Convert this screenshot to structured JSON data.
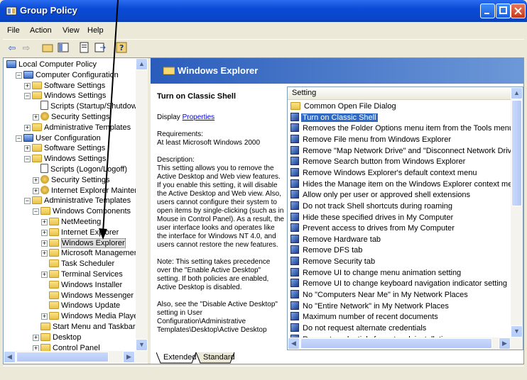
{
  "window": {
    "title": "Group Policy"
  },
  "menu": [
    "File",
    "Action",
    "View",
    "Help"
  ],
  "toolbar": {
    "back": "⇦",
    "forward": "⇨"
  },
  "tree": [
    {
      "label": "Local Computer Policy",
      "level": 0,
      "icon": "policy-icon",
      "expander": ""
    },
    {
      "label": "Computer Configuration",
      "level": 1,
      "icon": "computer-icon",
      "expander": "-"
    },
    {
      "label": "Software Settings",
      "level": 2,
      "icon": "folder-icon",
      "expander": "+"
    },
    {
      "label": "Windows Settings",
      "level": 2,
      "icon": "folder-icon",
      "expander": "-"
    },
    {
      "label": "Scripts (Startup/Shutdow",
      "level": 3,
      "icon": "script-icon",
      "expander": ""
    },
    {
      "label": "Security Settings",
      "level": 3,
      "icon": "security-icon",
      "expander": "+"
    },
    {
      "label": "Administrative Templates",
      "level": 2,
      "icon": "folder-icon",
      "expander": "+"
    },
    {
      "label": "User Configuration",
      "level": 1,
      "icon": "user-icon",
      "expander": "-"
    },
    {
      "label": "Software Settings",
      "level": 2,
      "icon": "folder-icon",
      "expander": "+"
    },
    {
      "label": "Windows Settings",
      "level": 2,
      "icon": "folder-icon",
      "expander": "-"
    },
    {
      "label": "Scripts (Logon/Logoff)",
      "level": 3,
      "icon": "script-icon",
      "expander": ""
    },
    {
      "label": "Security Settings",
      "level": 3,
      "icon": "security-icon",
      "expander": "+"
    },
    {
      "label": "Internet Explorer Mainter",
      "level": 3,
      "icon": "ie-icon",
      "expander": "+"
    },
    {
      "label": "Administrative Templates",
      "level": 2,
      "icon": "folder-icon",
      "expander": "-"
    },
    {
      "label": "Windows Components",
      "level": 3,
      "icon": "folder-icon",
      "expander": "-"
    },
    {
      "label": "NetMeeting",
      "level": 4,
      "icon": "folder-icon",
      "expander": "+"
    },
    {
      "label": "Internet Explorer",
      "level": 4,
      "icon": "folder-icon",
      "expander": "+"
    },
    {
      "label": "Windows Explorer",
      "level": 4,
      "icon": "folder-icon",
      "expander": "+"
    },
    {
      "label": "Microsoft Managemen",
      "level": 4,
      "icon": "folder-icon",
      "expander": "+"
    },
    {
      "label": "Task Scheduler",
      "level": 4,
      "icon": "folder-icon",
      "expander": ""
    },
    {
      "label": "Terminal Services",
      "level": 4,
      "icon": "folder-icon",
      "expander": "+"
    },
    {
      "label": "Windows Installer",
      "level": 4,
      "icon": "folder-icon",
      "expander": ""
    },
    {
      "label": "Windows Messenger",
      "level": 4,
      "icon": "folder-icon",
      "expander": ""
    },
    {
      "label": "Windows Update",
      "level": 4,
      "icon": "folder-icon",
      "expander": ""
    },
    {
      "label": "Windows Media Playe",
      "level": 4,
      "icon": "folder-icon",
      "expander": "+"
    },
    {
      "label": "Start Menu and Taskbar",
      "level": 3,
      "icon": "folder-icon",
      "expander": ""
    },
    {
      "label": "Desktop",
      "level": 3,
      "icon": "folder-icon",
      "expander": "+"
    },
    {
      "label": "Control Panel",
      "level": 3,
      "icon": "folder-icon",
      "expander": "+"
    }
  ],
  "right": {
    "header": "Windows Explorer",
    "setting_title": "Turn on Classic Shell",
    "display_label": "Display",
    "properties_link": "Properties",
    "requirements_label": "Requirements:",
    "requirements": "At least Microsoft Windows 2000",
    "description_label": "Description:",
    "description": "This setting allows you to remove the Active Desktop and Web view features. If you enable this setting, it will disable the Active Desktop and Web view. Also, users cannot configure their system to open items by single-clicking (such as in Mouse in Control Panel). As a result, the user interface looks and operates like the interface for Windows NT 4.0, and users cannot restore the new features.",
    "note": "Note: This setting takes precedence over the \"Enable Active Desktop\" setting. If both policies are enabled, Active Desktop is disabled.",
    "also": "Also, see the \"Disable Active Desktop\" setting in User Configuration\\Administrative Templates\\Desktop\\Active Desktop"
  },
  "list": {
    "column_header": "Setting",
    "items": [
      {
        "label": "Common Open File Dialog",
        "type": "folder"
      },
      {
        "label": "Turn on Classic Shell",
        "type": "setting",
        "selected": true
      },
      {
        "label": "Removes the Folder Options menu item from the Tools menu",
        "type": "setting"
      },
      {
        "label": "Remove File menu from Windows Explorer",
        "type": "setting"
      },
      {
        "label": "Remove \"Map Network Drive\" and \"Disconnect Network Drive\"",
        "type": "setting"
      },
      {
        "label": "Remove Search button from Windows Explorer",
        "type": "setting"
      },
      {
        "label": "Remove Windows Explorer's default context menu",
        "type": "setting"
      },
      {
        "label": "Hides the Manage item on the Windows Explorer context menu",
        "type": "setting"
      },
      {
        "label": "Allow only per user or approved shell extensions",
        "type": "setting"
      },
      {
        "label": "Do not track Shell shortcuts during roaming",
        "type": "setting"
      },
      {
        "label": "Hide these specified drives in My Computer",
        "type": "setting"
      },
      {
        "label": "Prevent access to drives from My Computer",
        "type": "setting"
      },
      {
        "label": "Remove Hardware tab",
        "type": "setting"
      },
      {
        "label": "Remove DFS tab",
        "type": "setting"
      },
      {
        "label": "Remove Security tab",
        "type": "setting"
      },
      {
        "label": "Remove UI to change menu animation setting",
        "type": "setting"
      },
      {
        "label": "Remove UI to change keyboard navigation indicator setting",
        "type": "setting"
      },
      {
        "label": "No \"Computers Near Me\" in My Network Places",
        "type": "setting"
      },
      {
        "label": "No \"Entire Network\" in My Network Places",
        "type": "setting"
      },
      {
        "label": "Maximum number of recent documents",
        "type": "setting"
      },
      {
        "label": "Do not request alternate credentials",
        "type": "setting"
      },
      {
        "label": "Request credentials for network installations",
        "type": "setting"
      }
    ]
  },
  "tabs": [
    "Extended",
    "Standard"
  ],
  "colors": {
    "selection": "#316ac5",
    "title_bar": "#0a4ad6",
    "header": "#2a5cbb"
  }
}
